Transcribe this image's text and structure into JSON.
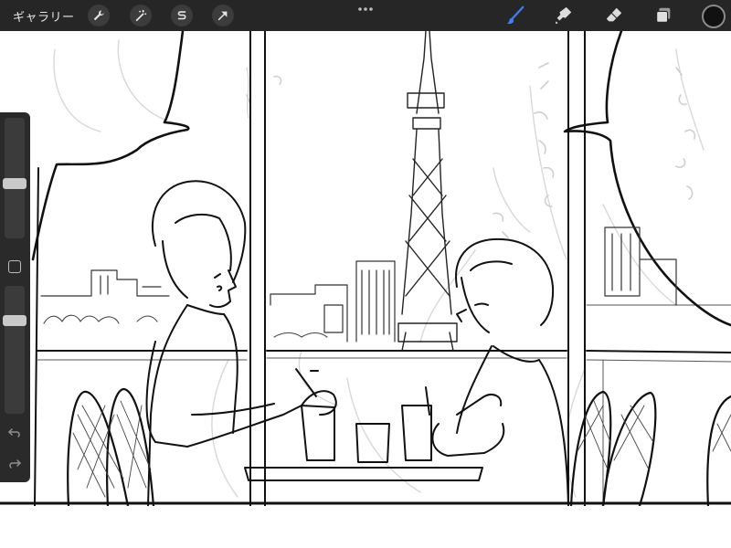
{
  "toolbar": {
    "gallery_label": "ギャラリー"
  },
  "colors": {
    "toolbar_bg": "#262626",
    "active_brush": "#3f7ff7",
    "current_color": "#111111"
  },
  "icons": {
    "actions": "wrench-icon",
    "adjustments": "magic-wand-icon",
    "selection": "selection-s-icon",
    "transform": "arrow-cursor-icon",
    "more": "ellipsis-icon",
    "brush": "brush-icon",
    "smudge": "smudge-icon",
    "eraser": "eraser-icon",
    "layers": "layers-icon",
    "undo": "undo-icon",
    "redo": "redo-icon"
  },
  "sidebar": {
    "brush_size_level": 0.45,
    "opacity_level": 0.75
  }
}
